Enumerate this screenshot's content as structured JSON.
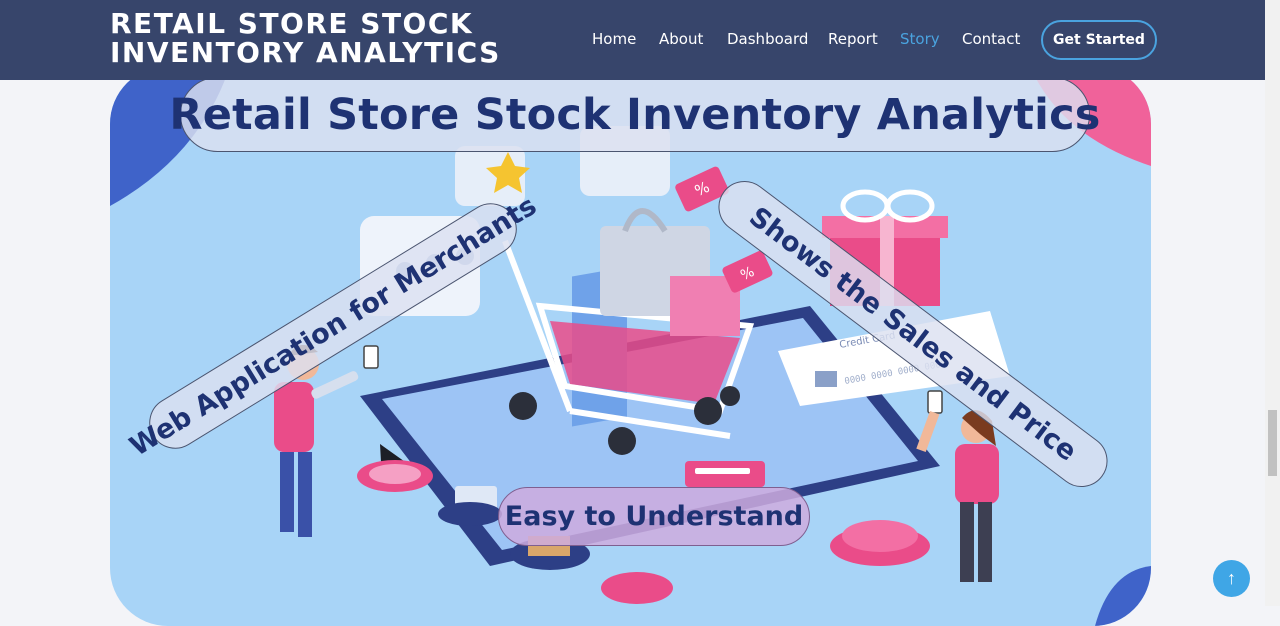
{
  "header": {
    "brand_line1": "RETAIL STORE STOCK",
    "brand_line2": "INVENTORY ANALYTICS",
    "nav": [
      {
        "label": "Home",
        "active": false
      },
      {
        "label": "About",
        "active": false
      },
      {
        "label": "Dashboard",
        "active": false
      },
      {
        "label": "Report",
        "active": false
      },
      {
        "label": "Story",
        "active": true
      },
      {
        "label": "Contact",
        "active": false
      }
    ],
    "cta_label": "Get Started"
  },
  "hero": {
    "title": "Retail Store Stock Inventory Analytics",
    "tag_left": "Web Application for Merchants",
    "tag_right": "Shows the Sales and Price",
    "tag_bottom": "Easy to Understand",
    "card_label": "Credit Card"
  },
  "colors": {
    "header_bg": "#37456b",
    "accent": "#4aa3df",
    "title_text": "#1e3273",
    "hero_bg": "#a8d4f7",
    "pink": "#ea4c89"
  },
  "icons": {
    "back_to_top": "arrow-up-icon"
  }
}
